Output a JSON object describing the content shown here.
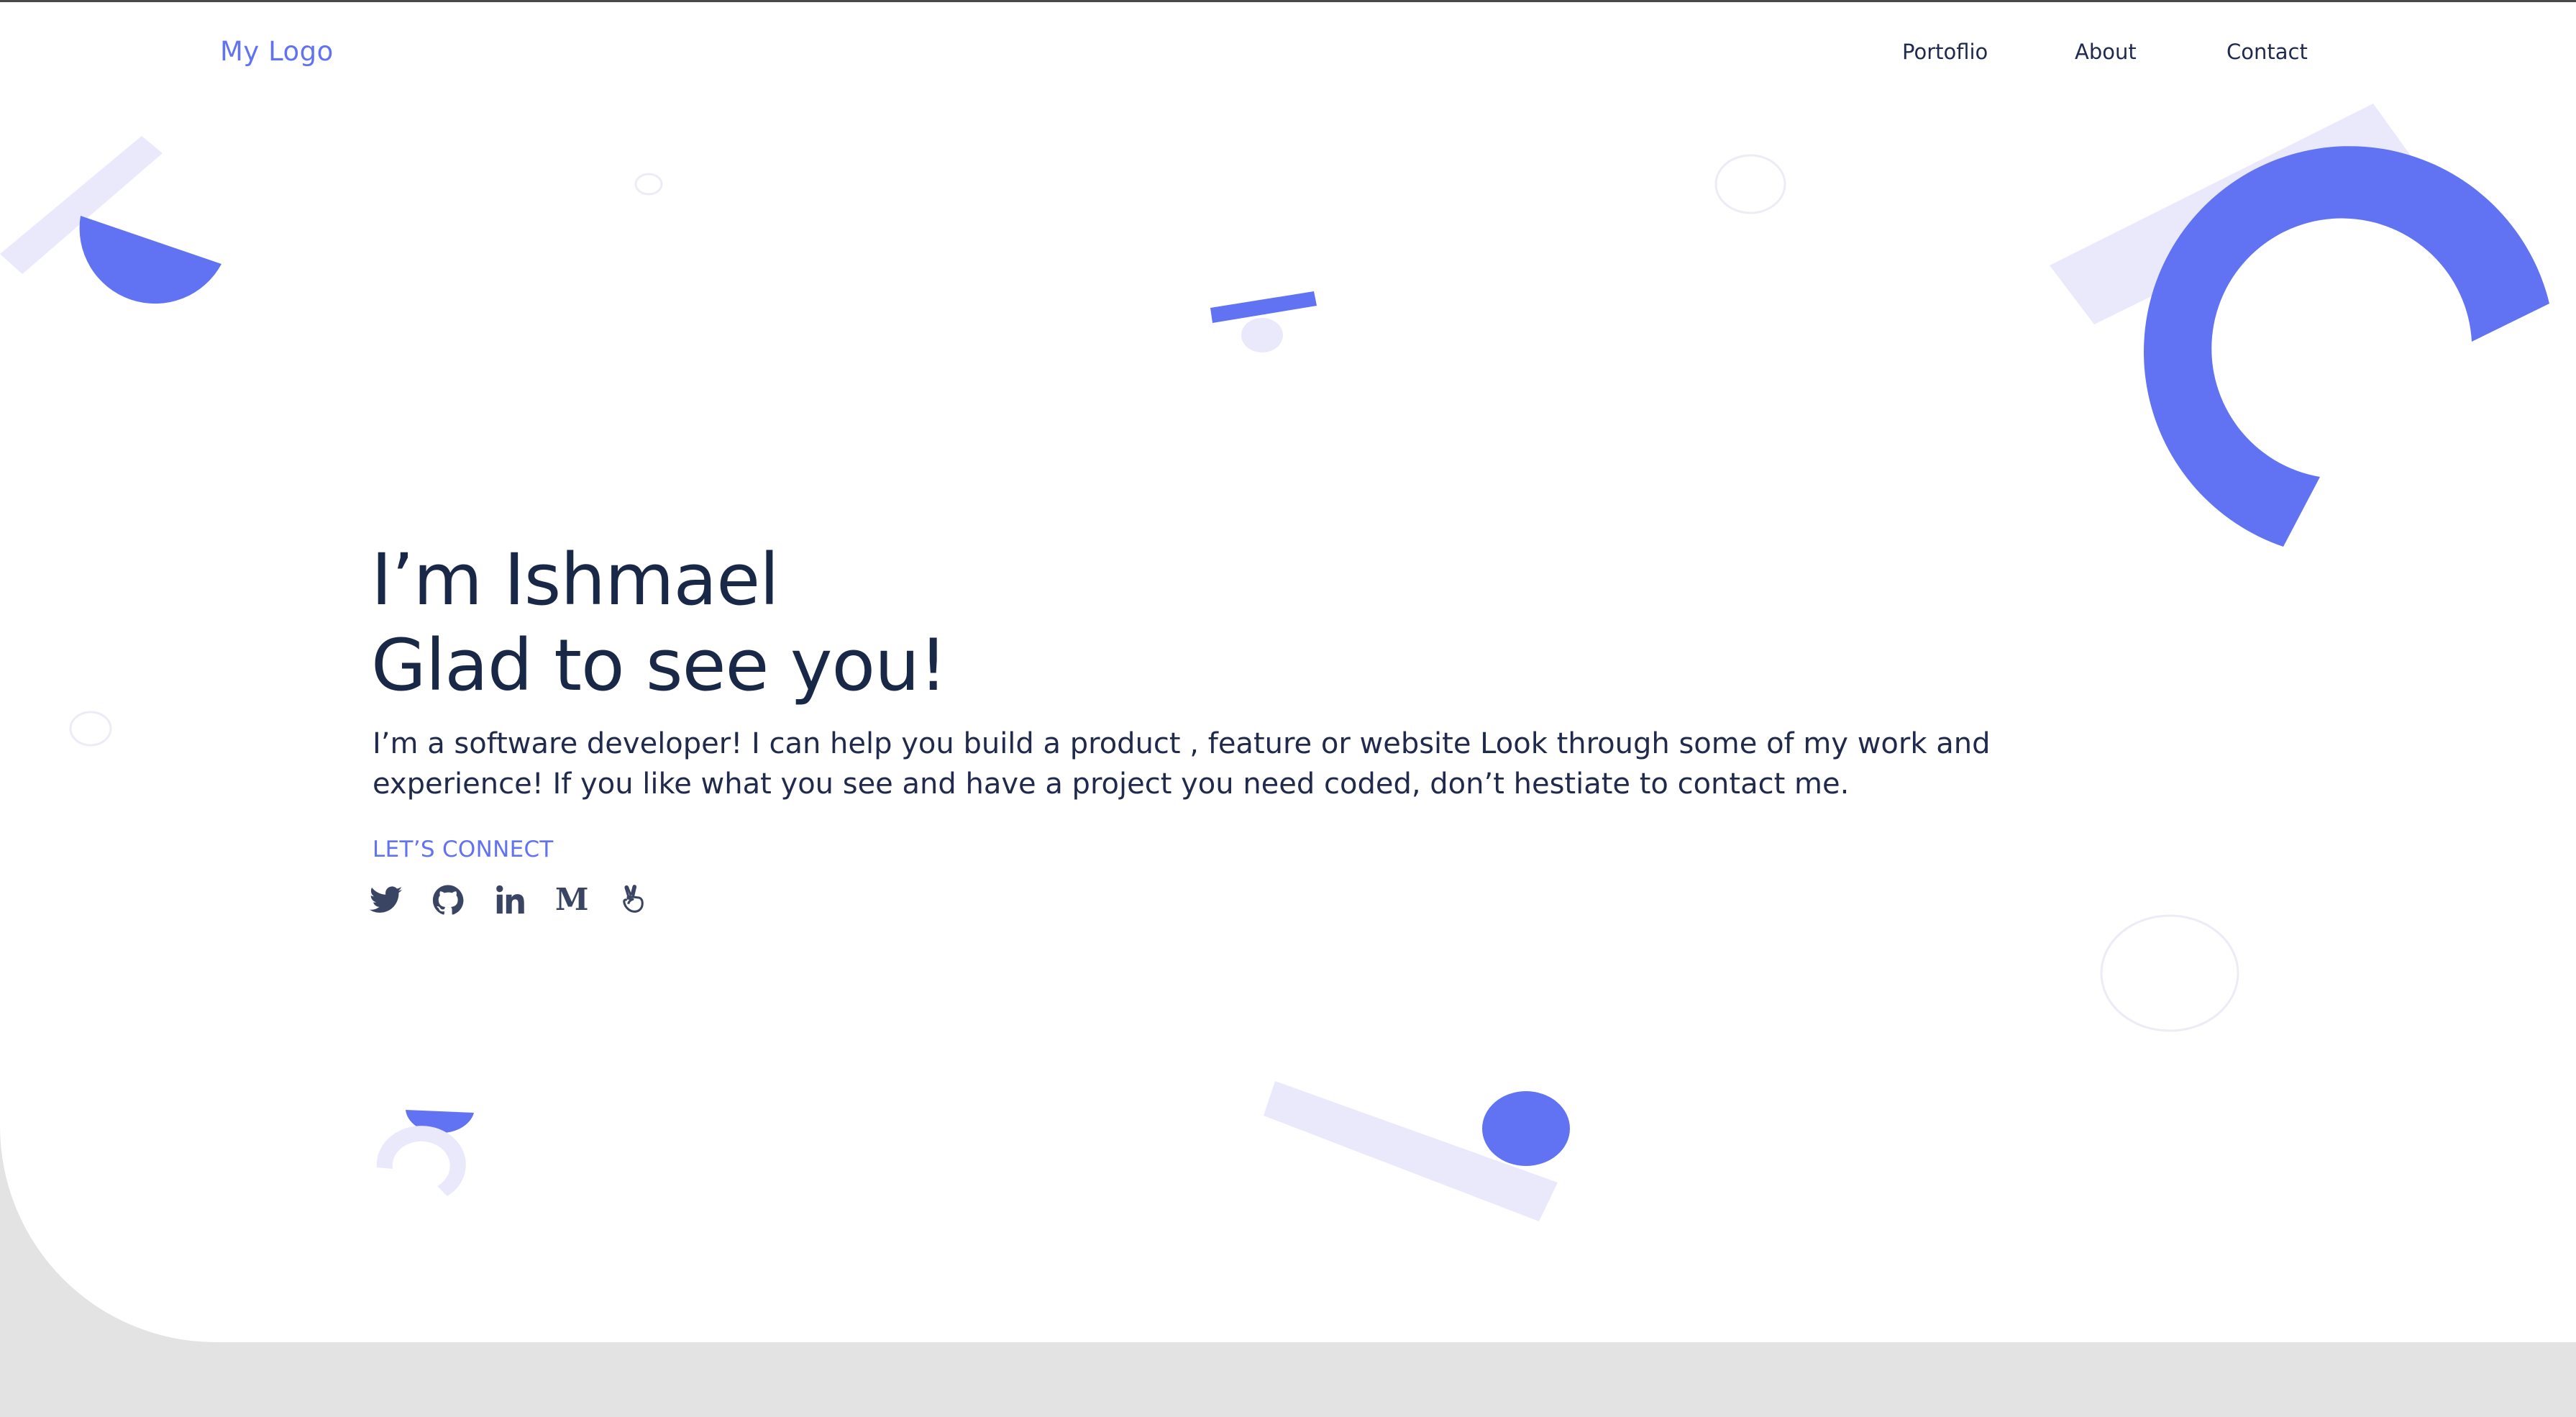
{
  "header": {
    "logo": "My Logo",
    "nav": [
      {
        "label": "Portoflio"
      },
      {
        "label": "About"
      },
      {
        "label": "Contact"
      }
    ]
  },
  "hero": {
    "line1": "I’m Ishmael",
    "line2": "Glad to see you!",
    "bio": "I’m a software developer! I can help you build a product , feature or website Look through some of my work and experience! If you like what you see and have a project you need coded, don’t hestiate to contact me.",
    "connect_label": "LET’S CONNECT"
  },
  "social": [
    {
      "icon": "twitter-icon"
    },
    {
      "icon": "github-icon"
    },
    {
      "icon": "linkedin-icon"
    },
    {
      "icon": "medium-icon",
      "glyph": "M"
    },
    {
      "icon": "angellist-icon"
    }
  ],
  "colors": {
    "accent": "#6172f3",
    "accent_light": "#e9e9fb",
    "text_dark": "#1a2848",
    "footer_bg": "#e3e3e4"
  }
}
